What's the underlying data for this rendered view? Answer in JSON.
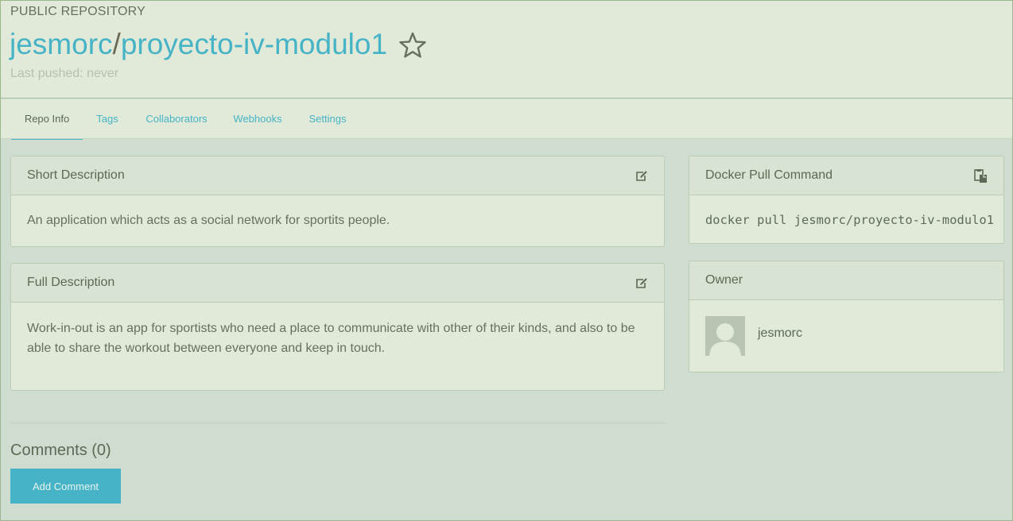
{
  "header": {
    "repo_kind": "PUBLIC REPOSITORY",
    "namespace": "jesmorc",
    "separator": "/",
    "repo_name": "proyecto-iv-modulo1",
    "last_pushed": "Last pushed: never"
  },
  "tabs": [
    {
      "label": "Repo Info",
      "active": true
    },
    {
      "label": "Tags",
      "active": false
    },
    {
      "label": "Collaborators",
      "active": false
    },
    {
      "label": "Webhooks",
      "active": false
    },
    {
      "label": "Settings",
      "active": false
    }
  ],
  "short_description": {
    "title": "Short Description",
    "text": "An application which acts as a social network for sportits people."
  },
  "full_description": {
    "title": "Full Description",
    "text": "Work-in-out is an app for sportists who need a place to communicate with other of their kinds, and also to be able to share the workout between everyone and keep in touch."
  },
  "docker_pull": {
    "title": "Docker Pull Command",
    "command": "docker pull jesmorc/proyecto-iv-modulo1"
  },
  "owner": {
    "title": "Owner",
    "name": "jesmorc"
  },
  "comments": {
    "title": "Comments (0)",
    "add_label": "Add Comment"
  },
  "icons": {
    "star": "star-outline-icon",
    "edit": "edit-icon",
    "copy": "clipboard-copy-icon",
    "avatar": "user-avatar-icon"
  },
  "colors": {
    "accent": "#46b4c6",
    "background": "#cfddd0",
    "panel": "#e1e9d8"
  }
}
